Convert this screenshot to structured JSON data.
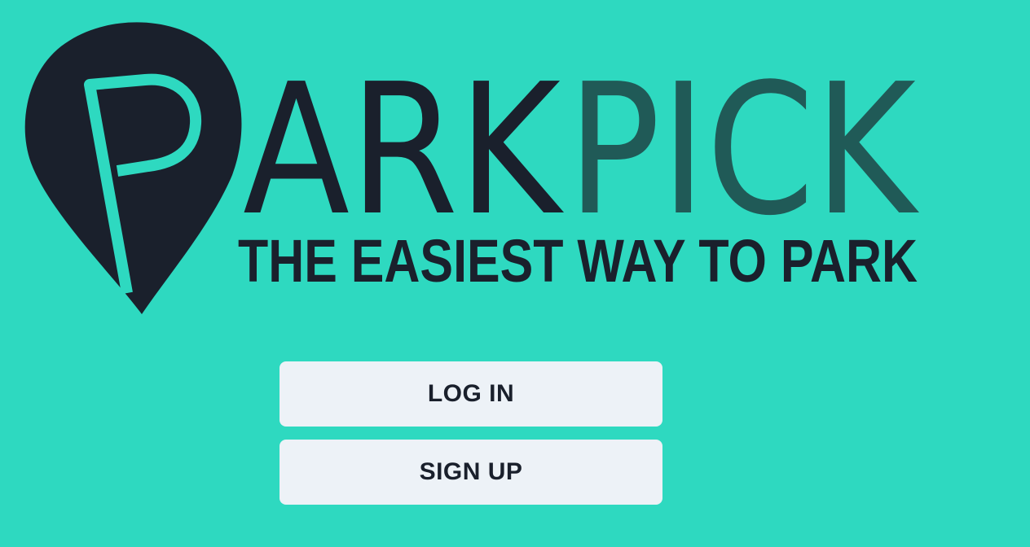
{
  "brand": {
    "word_dark": "ARK",
    "word_accent": "PICK",
    "tagline": "THE EASIEST WAY TO PARK",
    "pin_letter": "P",
    "colors": {
      "background": "#2ed9c0",
      "dark": "#1a202c",
      "accent": "#205a57",
      "button_bg": "#edf2f7"
    },
    "icon": "map-pin-parking-icon"
  },
  "actions": {
    "login_label": "LOG IN",
    "signup_label": "SIGN UP"
  }
}
